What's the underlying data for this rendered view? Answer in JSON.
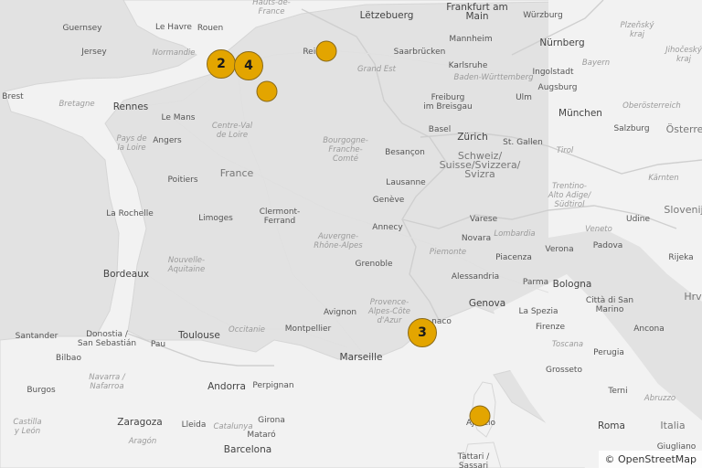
{
  "map": {
    "attribution": "© OpenStreetMap",
    "colors": {
      "land": "#f2f2f2",
      "sea": "#e2e2e2",
      "border": "#cfcfcf",
      "marker": "#e3a500",
      "marker_stroke": "#8a6a1a"
    },
    "markers": [
      {
        "id": "paris-west",
        "count": "2"
      },
      {
        "id": "paris",
        "count": "4"
      },
      {
        "id": "orleans",
        "count": ""
      },
      {
        "id": "reims",
        "count": ""
      },
      {
        "id": "nice",
        "count": "3"
      },
      {
        "id": "ajaccio",
        "count": ""
      }
    ],
    "labels": {
      "guernsey": "Guernsey",
      "jersey": "Jersey",
      "le_havre": "Le Havre",
      "rouen": "Rouen",
      "normandie": "Normandie",
      "hauts_de_france": "Hauts-de-\nFrance",
      "letzebuerg": "Lëtzebuerg",
      "frankfurt": "Frankfurt am\nMain",
      "wurzburg": "Würzburg",
      "plzensky": "Plzeňský\nkraj",
      "mannheim": "Mannheim",
      "nurnberg": "Nürnberg",
      "reims": "Reims",
      "saarbrucken": "Saarbrücken",
      "karlsruhe": "Karlsruhe",
      "grand_est": "Grand Est",
      "baden": "Baden-Württemberg",
      "ingolstadt": "Ingolstadt",
      "bayern": "Bayern",
      "jihocesky": "Jihočeský\nkraj",
      "brest": "Brest",
      "bretagne": "Bretagne",
      "rennes": "Rennes",
      "le_mans": "Le Mans",
      "freiburg": "Freiburg\nim Breisgau",
      "ulm": "Ulm",
      "augsburg": "Augsburg",
      "munchen": "München",
      "oberosterreich": "Oberösterreich",
      "centre": "Centre-Val\nde Loire",
      "angers": "Angers",
      "pays_de_la_loire": "Pays de\nla Loire",
      "basel": "Basel",
      "zurich": "Zürich",
      "st_gallen": "St. Gallen",
      "salzburg": "Salzburg",
      "osterre": "Österre",
      "bourgogne": "Bourgogne-\nFranche-\nComté",
      "besancon": "Besançon",
      "schweiz": "Schweiz/\nSuisse/Svizzera/\nSvizra",
      "tirol": "Tirol",
      "kamten": "Kärnten",
      "france": "France",
      "poitiers": "Poitiers",
      "lausanne": "Lausanne",
      "trentino": "Trentino-\nAlto Adige/\nSüdtirol",
      "geneve": "Genève",
      "la_rochelle": "La Rochelle",
      "limoges": "Limoges",
      "clermont": "Clermont-\nFerrand",
      "annecy": "Annecy",
      "varese": "Varese",
      "udine": "Udine",
      "slovenij": "Slovenij",
      "veneto": "Veneto",
      "lombardia": "Lombardia",
      "auvergne": "Auvergne-\nRhône-Alpes",
      "novara": "Novara",
      "verona": "Verona",
      "padova": "Padova",
      "rijeka": "Rijeka",
      "piemonte": "Piemonte",
      "piacenza": "Piacenza",
      "bordeaux": "Bordeaux",
      "nouvelle_aquitaine": "Nouvelle-\nAquitaine",
      "grenoble": "Grenoble",
      "alessandria": "Alessandria",
      "parma": "Parma",
      "bologna": "Bologna",
      "genova": "Genova",
      "citta_di_san_marino": "Città di San\nMarino",
      "hrv": "Hrv",
      "provence": "Provence-\nAlpes-Côte\nd'Azur",
      "avignon": "Avignon",
      "la_spezia": "La Spezia",
      "montpellier": "Montpellier",
      "monaco": "naco",
      "santander": "Santander",
      "donostia": "Donostia /\nSan Sebastián",
      "toulouse": "Toulouse",
      "occitanie": "Occitanie",
      "firenze": "Firenze",
      "ancona": "Ancona",
      "pau": "Pau",
      "bilbao": "Bilbao",
      "toscana": "Toscana",
      "marseille": "Marseille",
      "perugia": "Perugia",
      "navarra": "Navarra /\nNafarroa",
      "grosseto": "Grosseto",
      "burgos": "Burgos",
      "andorra": "Andorra",
      "perpignan": "Perpignan",
      "terni": "Terni",
      "abruzzo": "Abruzzo",
      "castilla": "Castilla\ny León",
      "zaragoza": "Zaragoza",
      "lleida": "Lleida",
      "girona": "Girona",
      "ajaccio": "Ajaccio",
      "roma": "Roma",
      "italia": "Italia",
      "catalunya": "Catalunya",
      "aragon": "Aragón",
      "mataro": "Mataró",
      "barcelona": "Barcelona",
      "tattari": "Tàttari /\nSassari",
      "giugliano": "Giugliano"
    }
  }
}
